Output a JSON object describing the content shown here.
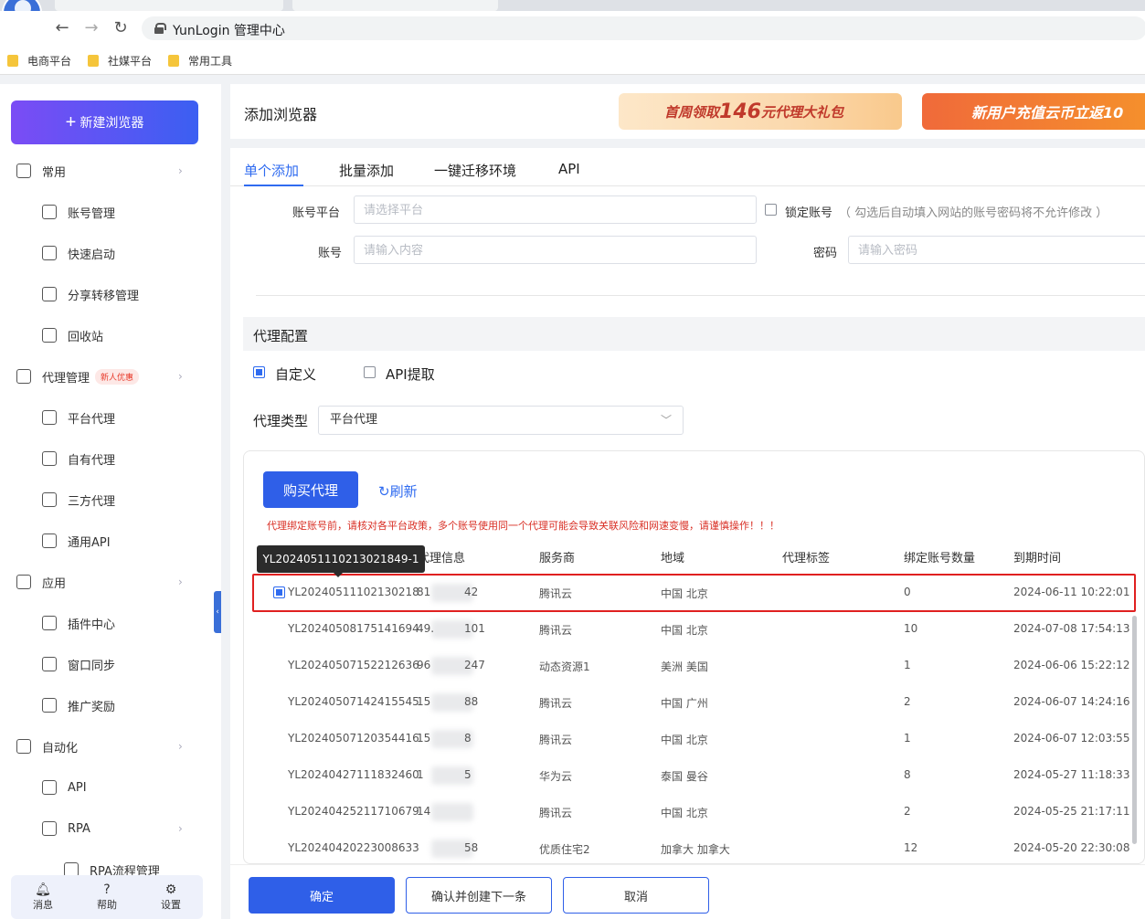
{
  "browser": {
    "address": "YunLogin 管理中心",
    "bookmarks": [
      "电商平台",
      "社媒平台",
      "常用工具"
    ]
  },
  "sidebar": {
    "new_browser": "新建浏览器",
    "items": [
      {
        "label": "常用",
        "icon": "home-icon",
        "type": "group",
        "chevron": true
      },
      {
        "label": "账号管理",
        "icon": "user-list-icon",
        "type": "sub"
      },
      {
        "label": "快速启动",
        "icon": "rocket-icon",
        "type": "sub"
      },
      {
        "label": "分享转移管理",
        "icon": "share-transfer-icon",
        "type": "sub"
      },
      {
        "label": "回收站",
        "icon": "trash-icon",
        "type": "sub"
      },
      {
        "label": "代理管理",
        "icon": "proxy-user-icon",
        "type": "group",
        "chevron": true,
        "badge": "新人优惠"
      },
      {
        "label": "平台代理",
        "icon": "platform-icon",
        "type": "sub"
      },
      {
        "label": "自有代理",
        "icon": "user-list-icon",
        "type": "sub"
      },
      {
        "label": "三方代理",
        "icon": "third-party-icon",
        "type": "sub"
      },
      {
        "label": "通用API",
        "icon": "api-link-icon",
        "type": "sub"
      },
      {
        "label": "应用",
        "icon": "apps-grid-icon",
        "type": "group",
        "chevron": true
      },
      {
        "label": "插件中心",
        "icon": "plugin-icon",
        "type": "sub"
      },
      {
        "label": "窗口同步",
        "icon": "window-sync-icon",
        "type": "sub"
      },
      {
        "label": "推广奖励",
        "icon": "megaphone-icon",
        "type": "sub"
      },
      {
        "label": "自动化",
        "icon": "robot-icon",
        "type": "group",
        "chevron": true
      },
      {
        "label": "API",
        "icon": "api-gear-icon",
        "type": "sub"
      },
      {
        "label": "RPA",
        "icon": "rpa-icon",
        "type": "sub",
        "chevron": true
      },
      {
        "label": "RPA流程管理",
        "icon": "flow-icon",
        "type": "subsub"
      }
    ],
    "footer": [
      {
        "label": "消息",
        "icon": "bell-icon"
      },
      {
        "label": "帮助",
        "icon": "help-icon"
      },
      {
        "label": "设置",
        "icon": "settings-icon"
      }
    ]
  },
  "header": {
    "title": "添加浏览器",
    "promo1_pre": "首周领取",
    "promo1_num": "146",
    "promo1_post": "元代理大礼包",
    "promo2": "新用户充值云币立返10"
  },
  "tabs": [
    "单个添加",
    "批量添加",
    "一键迁移环境",
    "API"
  ],
  "form": {
    "platform_label": "账号平台",
    "platform_placeholder": "请选择平台",
    "lock_label": "锁定账号",
    "lock_hint": "（ 勾选后自动填入网站的账号密码将不允许修改 ）",
    "account_label": "账号",
    "account_placeholder": "请输入内容",
    "password_label": "密码",
    "password_placeholder": "请输入密码"
  },
  "proxy": {
    "section_title": "代理配置",
    "mode_custom": "自定义",
    "mode_api": "API提取",
    "type_label": "代理类型",
    "type_value": "平台代理",
    "buy_button": "购买代理",
    "refresh": "刷新",
    "warning": "代理绑定账号前，请核对各平台政策，多个账号使用同一个代理可能会导致关联风险和网速变慢，请谨慎操作！！！",
    "tooltip": "YL2024051110213021849-1",
    "columns": [
      "代理信息",
      "服务商",
      "地域",
      "代理标签",
      "绑定账号数量",
      "到期时间"
    ],
    "rows": [
      {
        "id": "YL20240511102130218",
        "ip_a": "81",
        "ip_b": "42",
        "provider": "腾讯云",
        "region": "中国 北京",
        "tag": "",
        "count": "0",
        "expire": "2024-06-11 10:22:01",
        "checked": true
      },
      {
        "id": "YL20240508175141694",
        "ip_a": "49.",
        "ip_b": "101",
        "provider": "腾讯云",
        "region": "中国 北京",
        "tag": "",
        "count": "10",
        "expire": "2024-07-08 17:54:13"
      },
      {
        "id": "YL20240507152212636",
        "ip_a": "96",
        "ip_b": "247",
        "provider": "动态资源1",
        "region": "美洲 美国",
        "tag": "",
        "count": "1",
        "expire": "2024-06-06 15:22:12"
      },
      {
        "id": "YL20240507142415545",
        "ip_a": "15",
        "ip_b": "88",
        "provider": "腾讯云",
        "region": "中国 广州",
        "tag": "",
        "count": "2",
        "expire": "2024-06-07 14:24:16"
      },
      {
        "id": "YL20240507120354416",
        "ip_a": "15",
        "ip_b": "8",
        "provider": "腾讯云",
        "region": "中国 北京",
        "tag": "",
        "count": "1",
        "expire": "2024-06-07 12:03:55"
      },
      {
        "id": "YL20240427111832460",
        "ip_a": "1",
        "ip_b": "5",
        "provider": "华为云",
        "region": "泰国 曼谷",
        "tag": "",
        "count": "8",
        "expire": "2024-05-27 11:18:33"
      },
      {
        "id": "YL20240425211710679",
        "ip_a": "14",
        "ip_b": "",
        "provider": "腾讯云",
        "region": "中国 北京",
        "tag": "",
        "count": "2",
        "expire": "2024-05-25 21:17:11"
      },
      {
        "id": "YL20240420223008633",
        "ip_a": "",
        "ip_b": "58",
        "provider": "优质住宅2",
        "region": "加拿大 加拿大",
        "tag": "",
        "count": "12",
        "expire": "2024-05-20 22:30:08"
      }
    ]
  },
  "footer": {
    "confirm": "确定",
    "confirm_next": "确认并创建下一条",
    "cancel": "取消"
  }
}
